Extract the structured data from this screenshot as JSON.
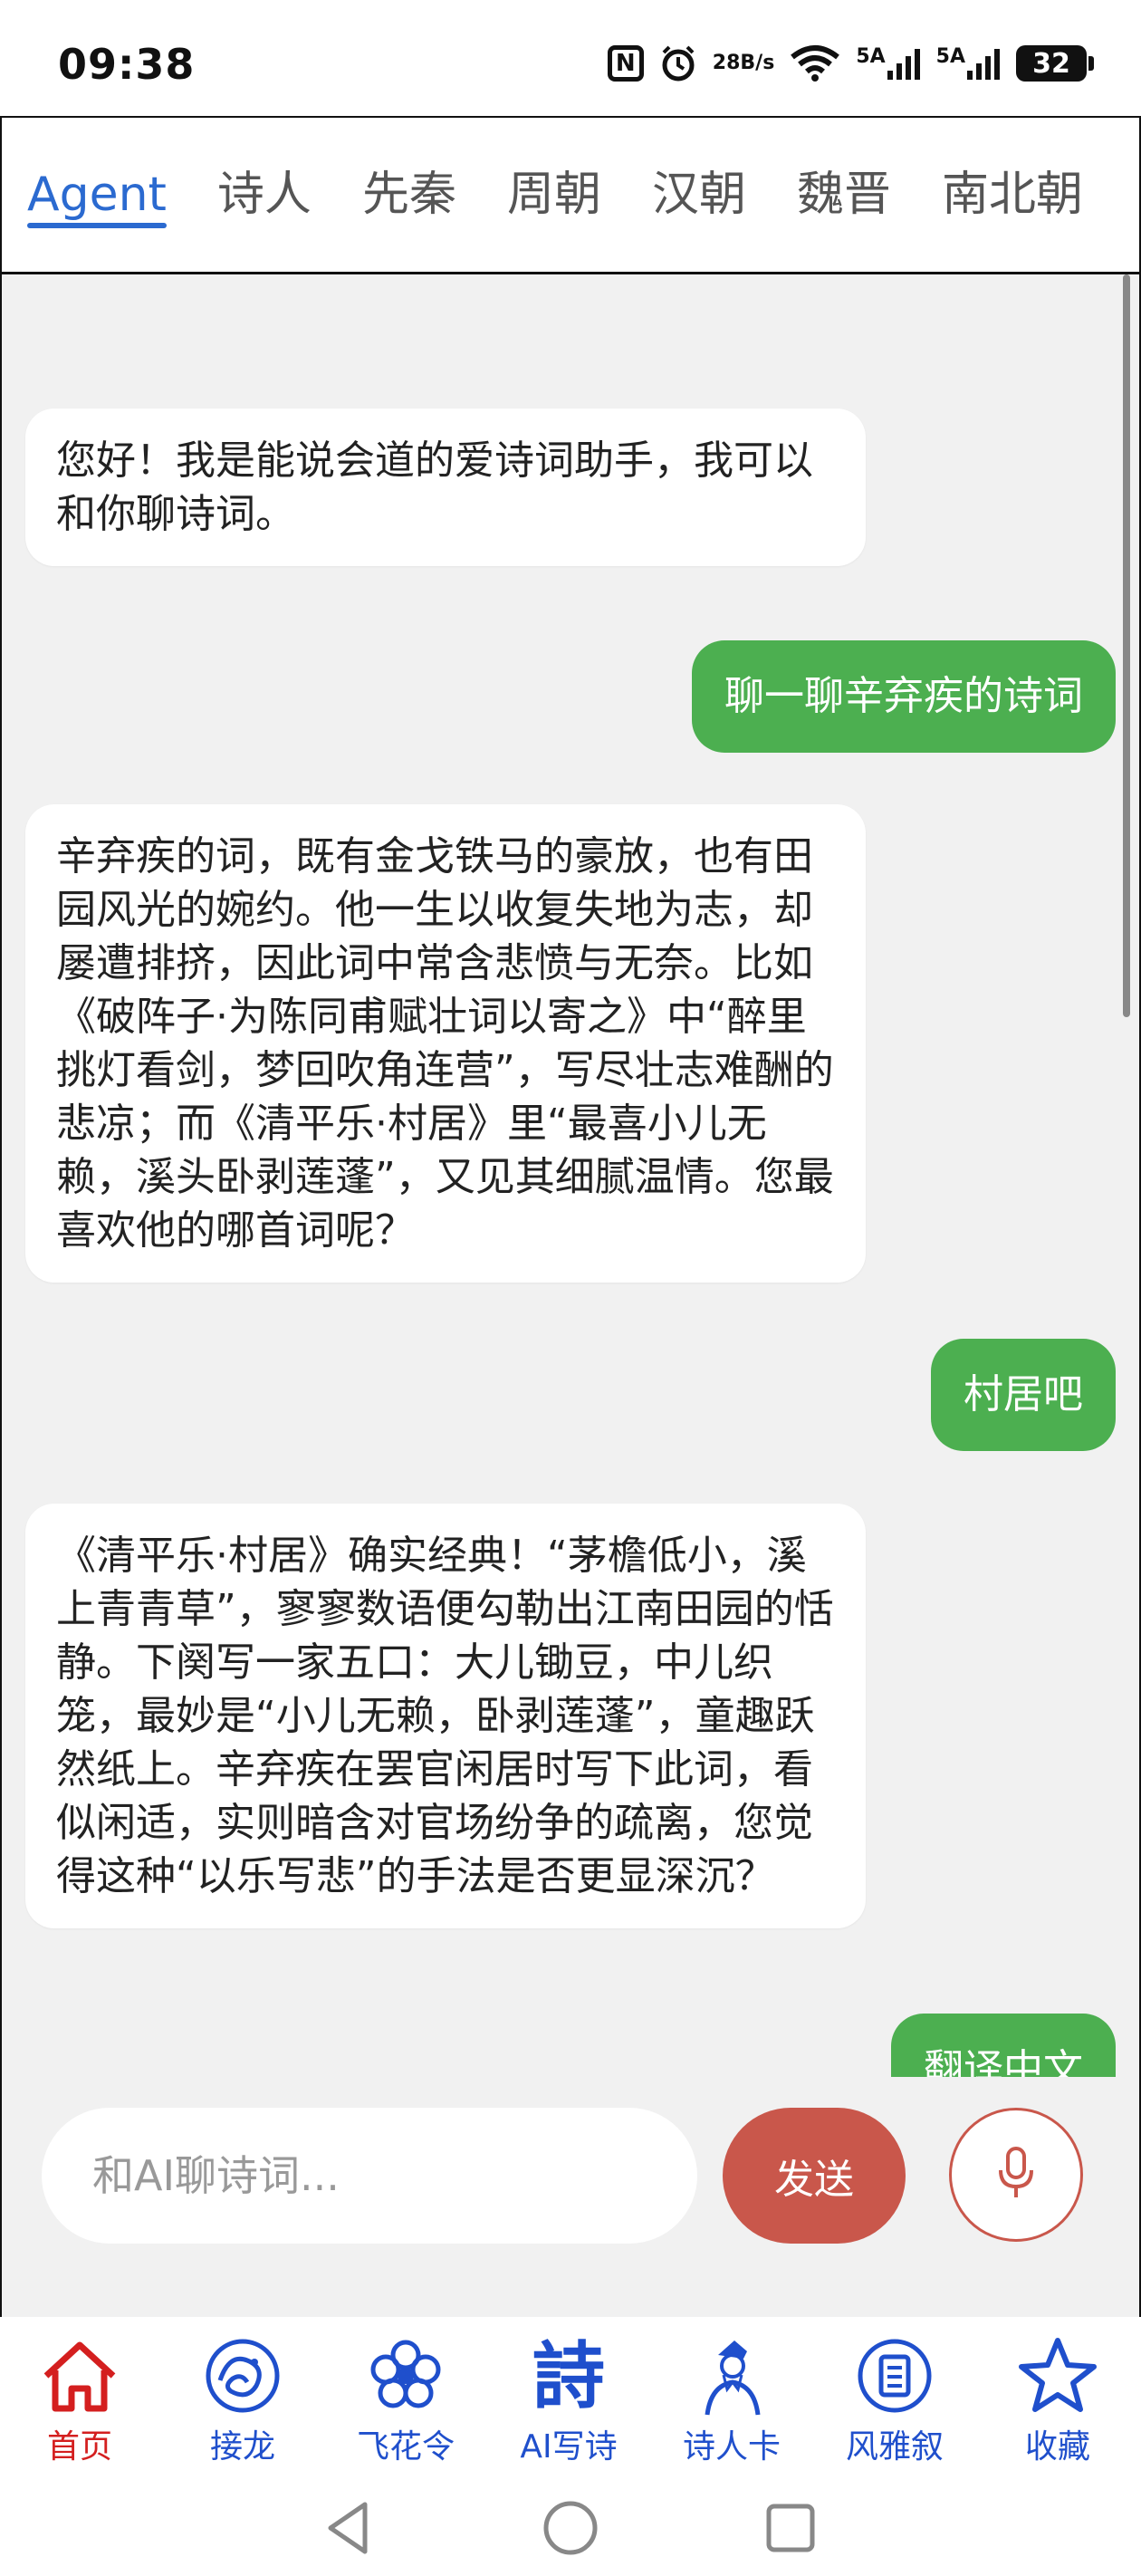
{
  "status_bar": {
    "time": "09:38",
    "nfc_icon": "N",
    "data_speed_value": "28",
    "data_speed_unit": "B/s",
    "signal1_label": "5A",
    "signal2_label": "5A",
    "battery": "32"
  },
  "tabs": [
    {
      "label": "Agent",
      "active": true
    },
    {
      "label": "诗人"
    },
    {
      "label": "先秦"
    },
    {
      "label": "周朝"
    },
    {
      "label": "汉朝"
    },
    {
      "label": "魏晋"
    },
    {
      "label": "南北朝"
    }
  ],
  "messages": [
    {
      "role": "ai",
      "text": "您好！我是能说会道的爱诗词助手，我可以和你聊诗词。"
    },
    {
      "role": "user",
      "text": "聊一聊辛弃疾的诗词"
    },
    {
      "role": "ai",
      "text": "辛弃疾的词，既有金戈铁马的豪放，也有田园风光的婉约。他一生以收复失地为志，却屡遭排挤，因此词中常含悲愤与无奈。比如《破阵子·为陈同甫赋壮词以寄之》中“醉里挑灯看剑，梦回吹角连营”，写尽壮志难酬的悲凉；而《清平乐·村居》里“最喜小儿无赖，溪头卧剥莲蓬”，又见其细腻温情。您最喜欢他的哪首词呢？"
    },
    {
      "role": "user",
      "text": "村居吧"
    },
    {
      "role": "ai",
      "text": "《清平乐·村居》确实经典！“茅檐低小，溪上青青草”，寥寥数语便勾勒出江南田园的恬静。下阕写一家五口：大儿锄豆，中儿织笼，最妙是“小儿无赖，卧剥莲蓬”，童趣跃然纸上。辛弃疾在罢官闲居时写下此词，看似闲适，实则暗含对官场纷争的疏离，您觉得这种“以乐写悲”的手法是否更显深沉？"
    },
    {
      "role": "user",
      "text": "翻译中文"
    },
    {
      "role": "ai",
      "text": ""
    }
  ],
  "input": {
    "placeholder": "和AI聊诗词...",
    "send_label": "发送",
    "mic_icon": "microphone-icon"
  },
  "bottom_nav": [
    {
      "label": "首页",
      "icon": "home-icon",
      "active": true
    },
    {
      "label": "接龙",
      "icon": "dragon-icon"
    },
    {
      "label": "飞花令",
      "icon": "flower-icon"
    },
    {
      "label": "AI写诗",
      "icon": "shi-char-icon",
      "glyph": "詩"
    },
    {
      "label": "诗人卡",
      "icon": "poet-icon"
    },
    {
      "label": "风雅叙",
      "icon": "scroll-icon"
    },
    {
      "label": "收藏",
      "icon": "star-icon"
    }
  ],
  "colors": {
    "accent_blue": "#2b6ad0",
    "user_bubble": "#4caf50",
    "send_button": "#c9574b",
    "nav_blue": "#1f4fcc",
    "nav_active_red": "#d41f1f"
  }
}
